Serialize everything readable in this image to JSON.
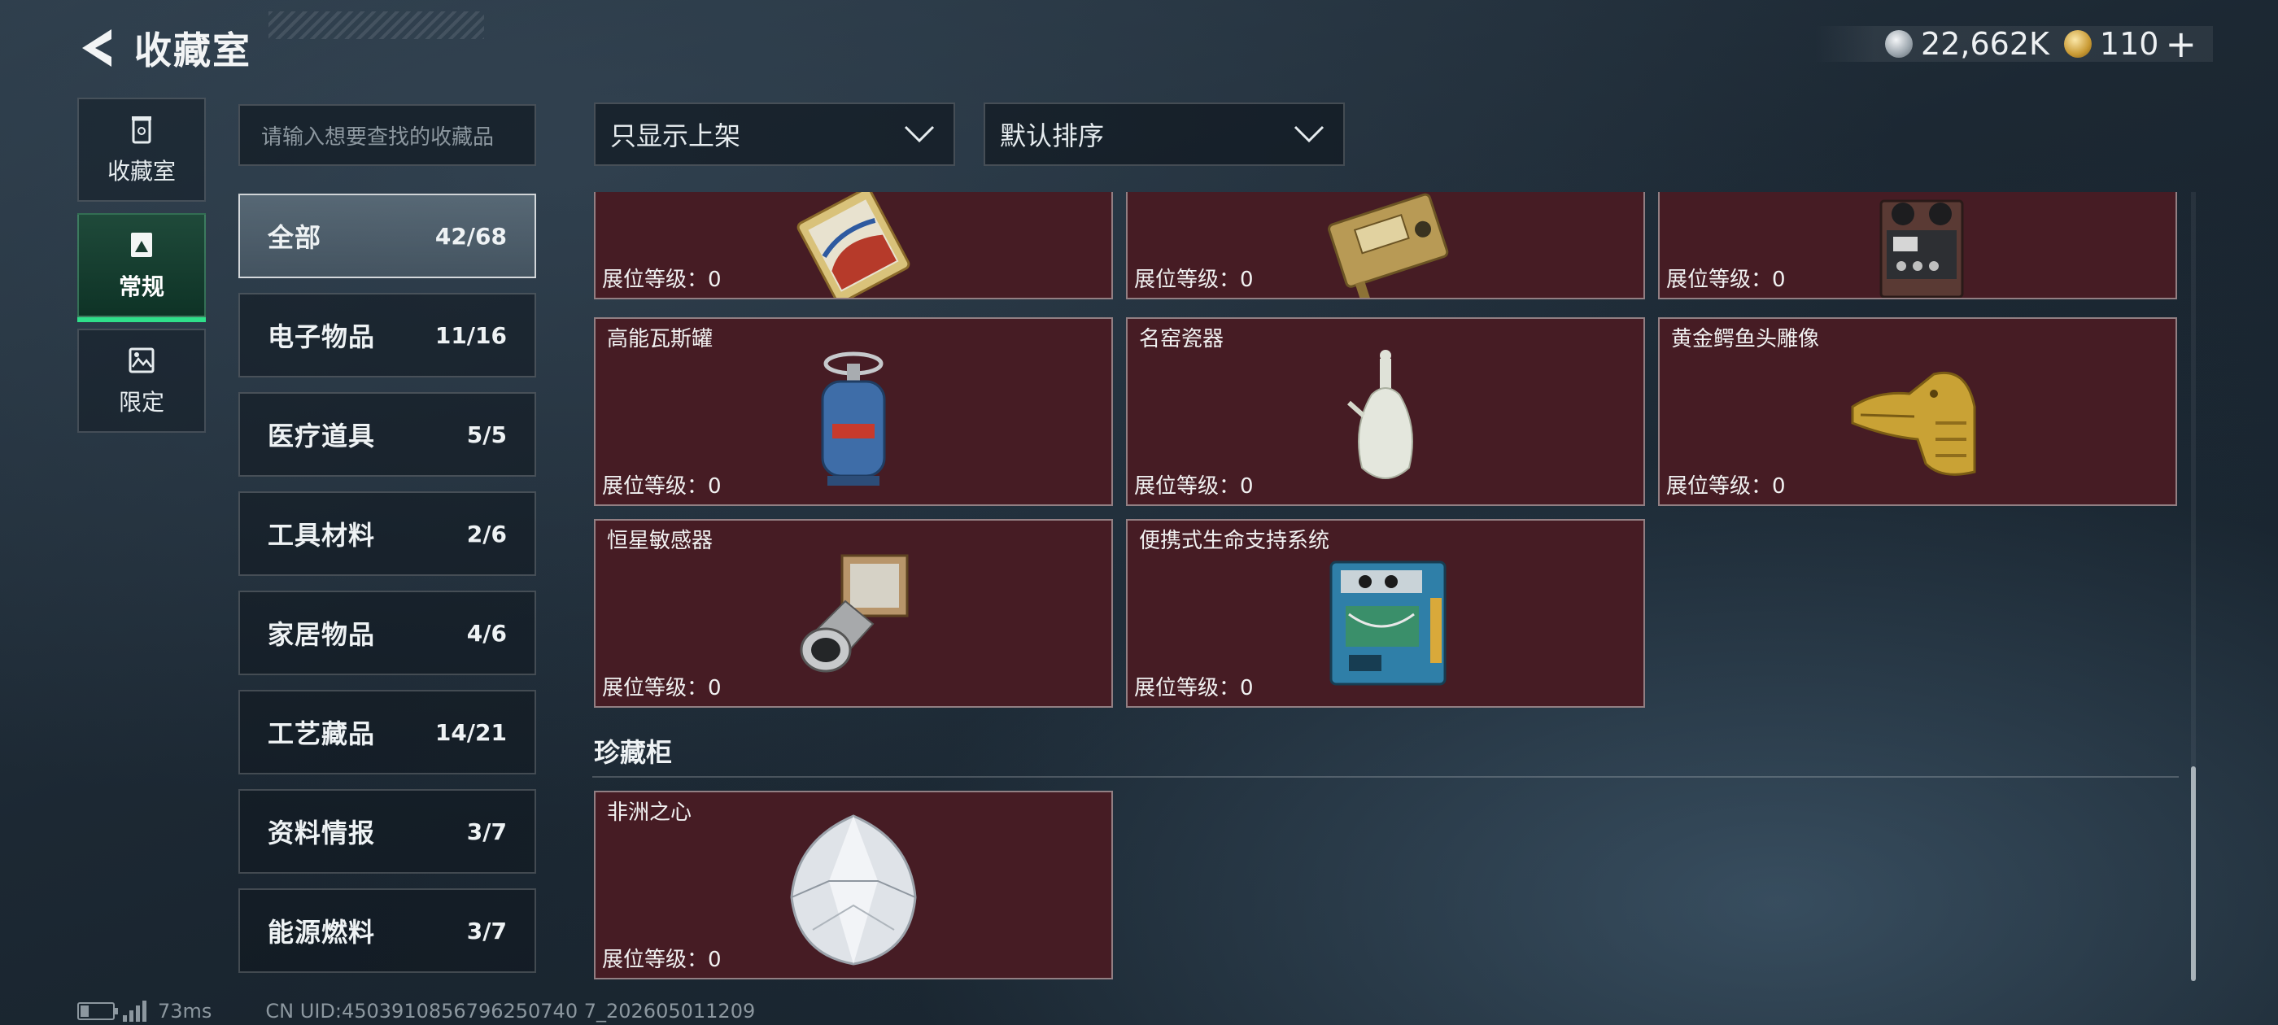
{
  "header": {
    "title": "收藏室"
  },
  "currency": [
    {
      "icon": "silver-coin-icon",
      "value": "22,662K"
    },
    {
      "icon": "gold-coin-icon",
      "value": "110"
    }
  ],
  "vnav": [
    {
      "label": "收藏室",
      "icon": "trash-bin-icon",
      "active": false
    },
    {
      "label": "常规",
      "icon": "photo-frame-icon",
      "active": true
    },
    {
      "label": "限定",
      "icon": "picture-icon",
      "active": false
    }
  ],
  "search": {
    "placeholder": "请输入想要查找的收藏品"
  },
  "filters": {
    "display": "只显示上架",
    "sort": "默认排序"
  },
  "categories": [
    {
      "name": "全部",
      "count": "42/68",
      "active": true
    },
    {
      "name": "电子物品",
      "count": "11/16"
    },
    {
      "name": "医疗道具",
      "count": "5/5"
    },
    {
      "name": "工具材料",
      "count": "2/6"
    },
    {
      "name": "家居物品",
      "count": "4/6"
    },
    {
      "name": "工艺藏品",
      "count": "14/21"
    },
    {
      "name": "资料情报",
      "count": "3/7"
    },
    {
      "name": "能源燃料",
      "count": "3/7"
    }
  ],
  "level_label": "展位等级：0",
  "items": [
    {
      "name": "",
      "art": "ornate-card"
    },
    {
      "name": "",
      "art": "gold-device"
    },
    {
      "name": "",
      "art": "reel-recorder"
    },
    {
      "name": "高能瓦斯罐",
      "art": "gas-canister"
    },
    {
      "name": "名窑瓷器",
      "art": "porcelain-vase"
    },
    {
      "name": "黄金鳄鱼头雕像",
      "art": "gold-crocodile"
    },
    {
      "name": "恒星敏感器",
      "art": "star-sensor"
    },
    {
      "name": "便携式生命支持系统",
      "art": "life-support"
    }
  ],
  "cabinet": {
    "title": "珍藏柜",
    "items": [
      {
        "name": "非洲之心",
        "art": "diamond"
      }
    ]
  },
  "footer": {
    "ping": "73ms",
    "uid": "CN UID:4503910856796250740 7_202605011209"
  },
  "colors": {
    "card_bg": "#461c24",
    "active_nav": "#2fe08a"
  }
}
